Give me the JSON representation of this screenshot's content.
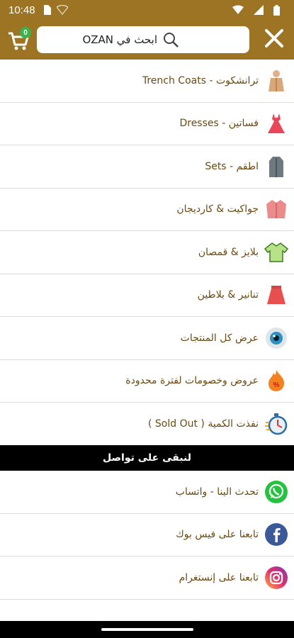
{
  "status_bar": {
    "time": "10:48",
    "icons_left": [
      "sim-card-icon",
      "signal-off-icon"
    ],
    "icons_right": [
      "wifi-icon",
      "cellular-icon",
      "battery-icon"
    ]
  },
  "header": {
    "cart_count": "0",
    "search_placeholder": "ابحث في OZAN",
    "accent_color": "#9c7424"
  },
  "menu": [
    {
      "label": "ترانشكوت - Trench Coats",
      "icon": "trench-coat-icon"
    },
    {
      "label": "فساتين - Dresses",
      "icon": "dress-icon"
    },
    {
      "label": "اطقم - Sets",
      "icon": "coat-set-icon"
    },
    {
      "label": "جواكيت & كارديجان",
      "icon": "jacket-icon"
    },
    {
      "label": "بلايز & قمصان",
      "icon": "blouse-icon"
    },
    {
      "label": "تنانير & بلاطين",
      "icon": "skirt-icon"
    },
    {
      "label": "عرض كل المنتجات",
      "icon": "eye-icon"
    },
    {
      "label": "عروض وخصومات لفترة محدودة",
      "icon": "discount-fire-icon"
    },
    {
      "label": "نفذت الكمية ( Sold Out )",
      "icon": "stopwatch-icon"
    }
  ],
  "contact": {
    "title": "لنبقى على تواصل",
    "items": [
      {
        "label": "تحدث الينا - واتساب",
        "icon": "whatsapp-icon"
      },
      {
        "label": "تابعنا على فيس بوك",
        "icon": "facebook-icon"
      },
      {
        "label": "تابعنا على إنستغرام",
        "icon": "instagram-icon"
      }
    ]
  }
}
